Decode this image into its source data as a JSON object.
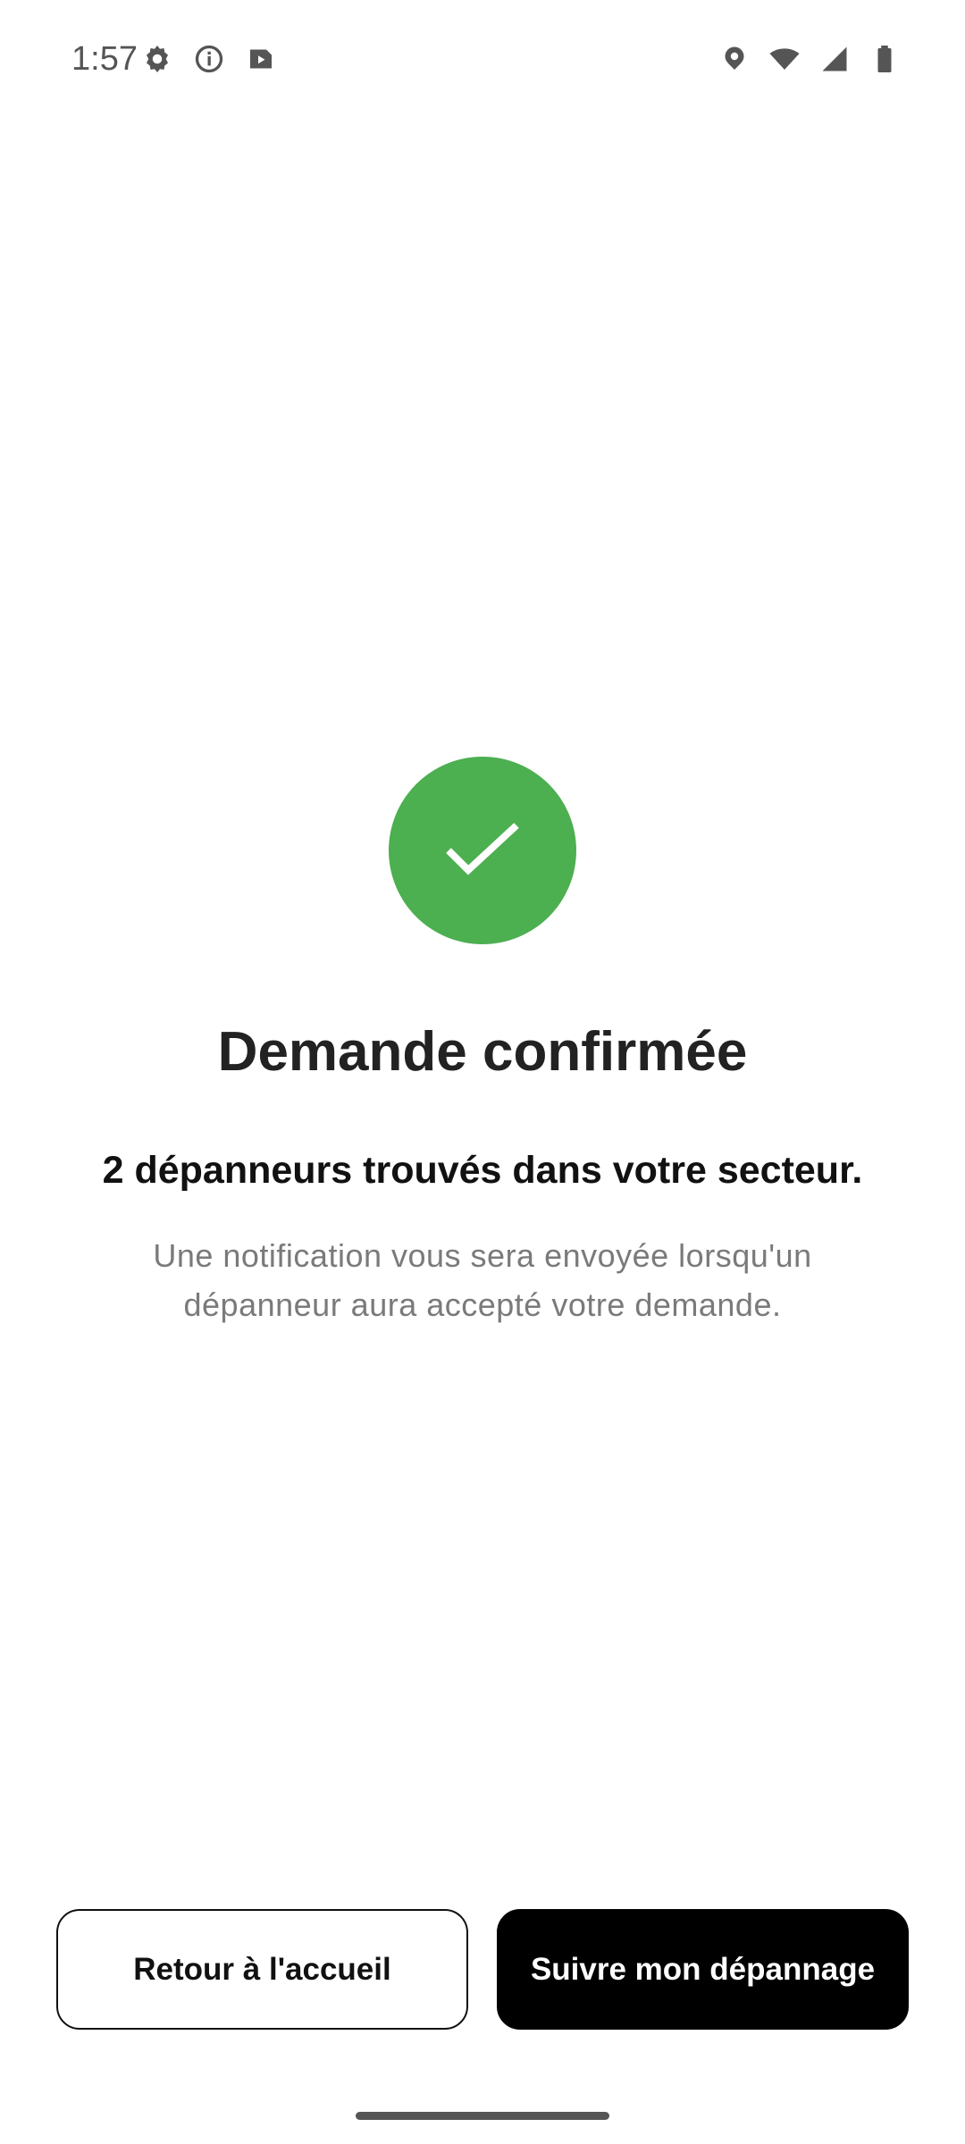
{
  "status_bar": {
    "time": "1:57",
    "left_icons": [
      "settings-icon",
      "info-icon",
      "media-icon"
    ],
    "right_icons": [
      "location-icon",
      "wifi-icon",
      "signal-icon",
      "battery-icon"
    ],
    "icon_color": "#555555"
  },
  "confirmation": {
    "icon": "checkmark-icon",
    "icon_color": "#4caf50",
    "title": "Demande confirmée",
    "subtitle": "2 dépanneurs trouvés dans votre secteur.",
    "message": "Une notification vous sera envoyée lorsqu'un dépanneur aura accepté votre demande."
  },
  "actions": {
    "home_label": "Retour à l'accueil",
    "track_label": "Suivre mon dépannage",
    "primary_color": "#000000"
  }
}
